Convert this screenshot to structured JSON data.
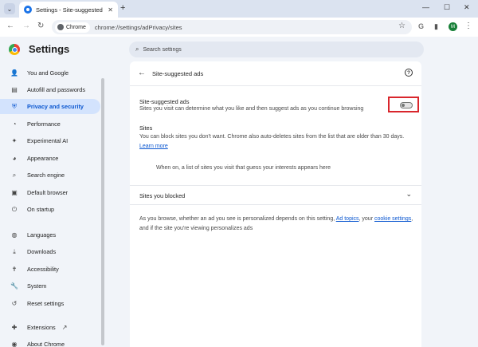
{
  "browser": {
    "tab_title": "Settings - Site-suggested ads",
    "tab_close": "✕",
    "new_tab": "+",
    "omnibox_chip": "Chrome",
    "url": "chrome://settings/adPrivacy/sites",
    "profile_initial": "M"
  },
  "header": {
    "app_title": "Settings",
    "search_placeholder": "Search settings"
  },
  "sidebar": {
    "items": [
      {
        "label": "You and Google",
        "icon": "google-icon"
      },
      {
        "label": "Autofill and passwords",
        "icon": "clipboard-key-icon"
      },
      {
        "label": "Privacy and security",
        "icon": "shield-icon",
        "active": true
      },
      {
        "label": "Performance",
        "icon": "speedometer-icon"
      },
      {
        "label": "Experimental AI",
        "icon": "sparkle-icon"
      },
      {
        "label": "Appearance",
        "icon": "palette-icon"
      },
      {
        "label": "Search engine",
        "icon": "search-icon"
      },
      {
        "label": "Default browser",
        "icon": "browser-window-icon"
      },
      {
        "label": "On startup",
        "icon": "power-icon"
      },
      {
        "label": "Languages",
        "icon": "globe-icon"
      },
      {
        "label": "Downloads",
        "icon": "download-icon"
      },
      {
        "label": "Accessibility",
        "icon": "accessibility-icon"
      },
      {
        "label": "System",
        "icon": "wrench-icon"
      },
      {
        "label": "Reset settings",
        "icon": "reset-icon"
      },
      {
        "label": "Extensions",
        "icon": "puzzle-icon"
      },
      {
        "label": "About Chrome",
        "icon": "chrome-icon"
      }
    ]
  },
  "main": {
    "page_title": "Site-suggested ads",
    "toggle": {
      "title": "Site-suggested ads",
      "description": "Sites you visit can determine what you like and then suggest ads as you continue browsing",
      "enabled": false
    },
    "sites": {
      "title": "Sites",
      "description": "You can block sites you don't want. Chrome also auto-deletes sites from the list that are older than 30 days.",
      "learn_more": "Learn more",
      "empty_message": "When on, a list of sites you visit that guess your interests appears here"
    },
    "blocked": {
      "label": "Sites you blocked"
    },
    "footer": {
      "text_1": "As you browse, whether an ad you see is personalized depends on this setting,",
      "link_1": "Ad topics",
      "text_2": ", your",
      "link_2": "cookie settings",
      "text_3": ",",
      "text_4": "and if the site you're viewing personalizes ads"
    }
  },
  "colors": {
    "accent": "#0b57d0",
    "active_bg": "#d3e3fd",
    "highlight_border": "#d9262c"
  }
}
